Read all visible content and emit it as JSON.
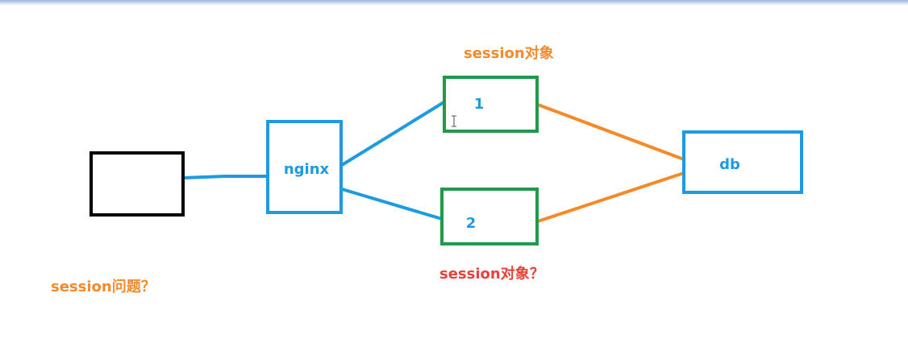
{
  "nodes": {
    "client": {
      "label": ""
    },
    "nginx": {
      "label": "nginx"
    },
    "server1": {
      "label": "1"
    },
    "server2": {
      "label": "2"
    },
    "db": {
      "label": "db"
    }
  },
  "annotations": {
    "session_object_top": "session对象",
    "session_object_question": "session对象？",
    "session_problem": "session问题？"
  },
  "colors": {
    "blue": "#1e9be0",
    "green": "#1f9a48",
    "black": "#000000",
    "orange": "#f58a2a",
    "red": "#e8423a"
  },
  "cursor_icon": "text-cursor-icon"
}
